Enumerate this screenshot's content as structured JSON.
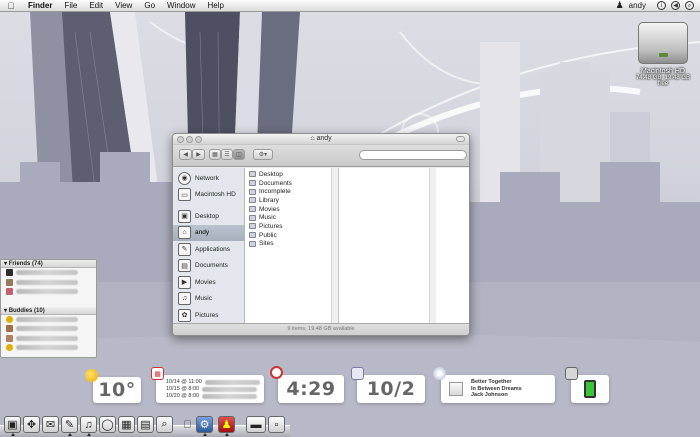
{
  "menubar": {
    "apple_icon": "apple-icon",
    "items": [
      "Finder",
      "File",
      "Edit",
      "View",
      "Go",
      "Window",
      "Help"
    ],
    "user": "andy",
    "status_icons": [
      "user-icon",
      "info-icon",
      "back-icon",
      "search-icon"
    ]
  },
  "desktop": {
    "hd": {
      "label": "Macintosh HD",
      "sub": "74.48 GB, 19.48 GB free"
    }
  },
  "finder": {
    "title": "andy",
    "sidebar": {
      "devices": [
        {
          "label": "Network",
          "icon": "globe-icon"
        },
        {
          "label": "Macintosh HD",
          "icon": "harddisk-icon"
        }
      ],
      "places": [
        {
          "label": "Desktop",
          "icon": "desktop-icon",
          "selected": false
        },
        {
          "label": "andy",
          "icon": "home-icon",
          "selected": true
        },
        {
          "label": "Applications",
          "icon": "applications-icon",
          "selected": false
        },
        {
          "label": "Documents",
          "icon": "documents-icon",
          "selected": false
        },
        {
          "label": "Movies",
          "icon": "movies-icon",
          "selected": false
        },
        {
          "label": "Music",
          "icon": "music-icon",
          "selected": false
        },
        {
          "label": "Pictures",
          "icon": "pictures-icon",
          "selected": false
        }
      ]
    },
    "files": [
      "Desktop",
      "Documents",
      "Incomplete",
      "Library",
      "Movies",
      "Music",
      "Pictures",
      "Public",
      "Sites"
    ],
    "status": "9 items, 19.48 GB available"
  },
  "buddies": {
    "friends_header": "Friends (74)",
    "buddies_header": "Buddies (10)"
  },
  "widgets": {
    "weather": {
      "temp": "10°"
    },
    "calendar": {
      "events": [
        "10/14 @ 11:00",
        "10/15 @ 8:00",
        "10/20 @ 8:00"
      ]
    },
    "clock": {
      "time": "4:29"
    },
    "date": {
      "value": "10/2"
    },
    "itunes": {
      "lines": [
        "Better Together",
        "In Between Dreams",
        "Jack Johnson"
      ]
    }
  },
  "colors": {
    "accent": "#6a7cb0",
    "selection": "#a6afbc",
    "widget_text": "#666666"
  }
}
